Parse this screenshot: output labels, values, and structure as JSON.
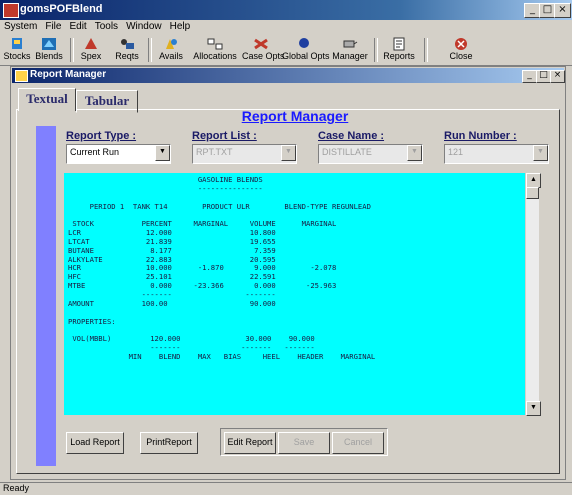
{
  "window": {
    "title": "gomsPOFBlend"
  },
  "menu": [
    "System",
    "File",
    "Edit",
    "Tools",
    "Window",
    "Help"
  ],
  "toolbar": [
    {
      "label": "Stocks",
      "icon": "stocks-icon"
    },
    {
      "label": "Blends",
      "icon": "blends-icon"
    },
    {
      "label": "Spex",
      "icon": "spex-icon"
    },
    {
      "label": "Reqts",
      "icon": "reqts-icon"
    },
    {
      "label": "Avails",
      "icon": "avails-icon"
    },
    {
      "label": "Allocations",
      "icon": "allocations-icon"
    },
    {
      "label": "Case Opts",
      "icon": "case-opts-icon"
    },
    {
      "label": "Global Opts",
      "icon": "global-opts-icon"
    },
    {
      "label": "Manager",
      "icon": "manager-icon"
    },
    {
      "label": "Reports",
      "icon": "reports-icon"
    },
    {
      "label": "Close",
      "icon": "close-icon"
    }
  ],
  "child": {
    "title": "Report Manager",
    "tabs": [
      "Textual",
      "Tabular"
    ],
    "heading": "Report Manager",
    "fields": {
      "report_type": {
        "label": "Report Type :",
        "value": "Current Run"
      },
      "report_list": {
        "label": "Report List :",
        "value": "RPT.TXT"
      },
      "case_name": {
        "label": "Case Name :",
        "value": "DISTILLATE"
      },
      "run_number": {
        "label": "Run Number :",
        "value": "121"
      }
    },
    "report_text": "                              GASOLINE BLENDS\n                              ---------------\n\n     PERIOD 1  TANK T14        PRODUCT ULR        BLEND-TYPE REGUNLEAD\n\n STOCK           PERCENT     MARGINAL     VOLUME      MARGINAL\nLCR               12.000                  10.800\nLTCAT             21.839                  19.655\nBUTANE             8.177                   7.359\nALKYLATE          22.883                  20.595\nHCR               10.000      -1.870       9.000        -2.078\nHFC               25.101                  22.591\nMTBE               0.000     -23.366       0.000       -25.963\n                 -------                 -------\nAMOUNT           100.00                   90.000\n\nPROPERTIES:\n\n VOL(MBBL)         120.000               30.000    90.000\n                   -------              -------   -------\n              MIN    BLEND    MAX   BIAS     HEEL    HEADER    MARGINAL",
    "buttons": {
      "load": "Load Report",
      "print": "PrintReport",
      "edit": "Edit Report",
      "save": "Save",
      "cancel": "Cancel"
    }
  },
  "status": "Ready",
  "colors": {
    "report_bg": "#00ffff",
    "sidebar": "#8080ff",
    "heading": "#1a1aff"
  }
}
